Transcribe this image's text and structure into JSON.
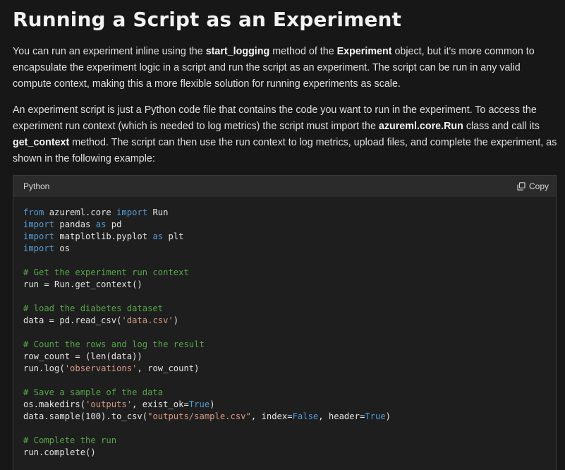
{
  "title": "Running a Script as an Experiment",
  "para1": {
    "t1": "You can run an experiment inline using the ",
    "b1": "start_logging",
    "t2": " method of the ",
    "b2": "Experiment",
    "t3": " object, but it's more common to encapsulate the experiment logic in a script and run the script as an experiment. The script can be run in any valid compute context, making this a more flexible solution for running experiments as scale."
  },
  "para2": {
    "t1": "An experiment script is just a Python code file that contains the code you want to run in the experiment. To access the experiment run context (which is needed to log metrics) the script must import the ",
    "b1": "azureml.core.Run",
    "t2": " class and call its ",
    "b2": "get_context",
    "t3": " method. The script can then use the run context to log metrics, upload files, and complete the experiment, as shown in the following example:"
  },
  "code": {
    "language": "Python",
    "copy_label": "Copy",
    "lines": [
      [
        {
          "c": "kw",
          "t": "from"
        },
        {
          "c": "",
          "t": " azureml.core "
        },
        {
          "c": "kw",
          "t": "import"
        },
        {
          "c": "",
          "t": " Run"
        }
      ],
      [
        {
          "c": "kw",
          "t": "import"
        },
        {
          "c": "",
          "t": " pandas "
        },
        {
          "c": "kw",
          "t": "as"
        },
        {
          "c": "",
          "t": " pd"
        }
      ],
      [
        {
          "c": "kw",
          "t": "import"
        },
        {
          "c": "",
          "t": " matplotlib.pyplot "
        },
        {
          "c": "kw",
          "t": "as"
        },
        {
          "c": "",
          "t": " plt"
        }
      ],
      [
        {
          "c": "kw",
          "t": "import"
        },
        {
          "c": "",
          "t": " os"
        }
      ],
      [],
      [
        {
          "c": "cm",
          "t": "# Get the experiment run context"
        }
      ],
      [
        {
          "c": "",
          "t": "run = Run.get_context()"
        }
      ],
      [],
      [
        {
          "c": "cm",
          "t": "# load the diabetes dataset"
        }
      ],
      [
        {
          "c": "",
          "t": "data = pd.read_csv("
        },
        {
          "c": "st",
          "t": "'data.csv'"
        },
        {
          "c": "",
          "t": ")"
        }
      ],
      [],
      [
        {
          "c": "cm",
          "t": "# Count the rows and log the result"
        }
      ],
      [
        {
          "c": "",
          "t": "row_count = (len(data))"
        }
      ],
      [
        {
          "c": "",
          "t": "run.log("
        },
        {
          "c": "st",
          "t": "'observations'"
        },
        {
          "c": "",
          "t": ", row_count)"
        }
      ],
      [],
      [
        {
          "c": "cm",
          "t": "# Save a sample of the data"
        }
      ],
      [
        {
          "c": "",
          "t": "os.makedirs("
        },
        {
          "c": "st",
          "t": "'outputs'"
        },
        {
          "c": "",
          "t": ", exist_ok="
        },
        {
          "c": "bl",
          "t": "True"
        },
        {
          "c": "",
          "t": ")"
        }
      ],
      [
        {
          "c": "",
          "t": "data.sample(100).to_csv("
        },
        {
          "c": "st",
          "t": "\"outputs/sample.csv\""
        },
        {
          "c": "",
          "t": ", index="
        },
        {
          "c": "bl",
          "t": "False"
        },
        {
          "c": "",
          "t": ", header="
        },
        {
          "c": "bl",
          "t": "True"
        },
        {
          "c": "",
          "t": ")"
        }
      ],
      [],
      [
        {
          "c": "cm",
          "t": "# Complete the run"
        }
      ],
      [
        {
          "c": "",
          "t": "run.complete()"
        }
      ]
    ]
  },
  "colors": {
    "background": "#171717",
    "code_background": "#1e1e1e",
    "keyword": "#569cd6",
    "comment": "#57a64a",
    "string": "#d69d85"
  },
  "icons": {
    "copy": "copy-icon"
  }
}
